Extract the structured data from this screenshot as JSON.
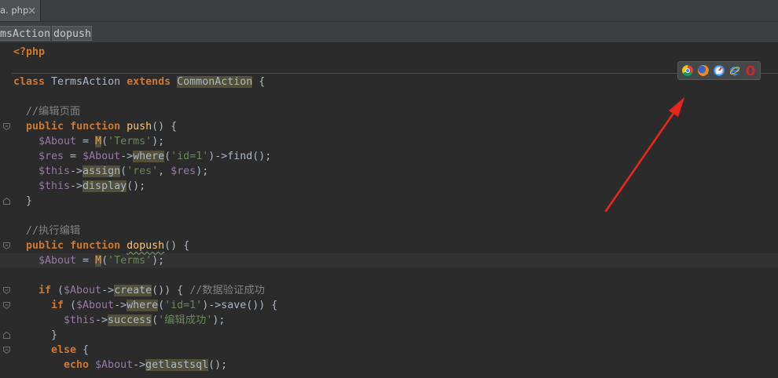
{
  "tabs": [
    {
      "label": "a. php"
    }
  ],
  "tab_close_icon": "close-icon",
  "breadcrumbs": [
    "msAction",
    "dopush"
  ],
  "browser_icons": [
    "chrome-icon",
    "firefox-icon",
    "safari-icon",
    "ie-icon",
    "opera-icon"
  ],
  "colors": {
    "editor_bg": "#2b2b2b",
    "chrome_bg": "#3c3f41",
    "text": "#a9b7c6",
    "keyword": "#cc7832",
    "variable": "#9876aa",
    "string": "#6a8759",
    "comment": "#808080",
    "function": "#ffc66d",
    "usage_highlight": "#52503a",
    "caret_line": "#323232",
    "annotation": "#e8261d"
  },
  "code": {
    "lines": [
      {
        "tokens": [
          {
            "t": "<?php",
            "k": "kw"
          }
        ]
      },
      {
        "tokens": []
      },
      {
        "tokens": [
          {
            "t": "class",
            "k": "kw"
          },
          {
            "t": " TermsAction ",
            "k": "plain"
          },
          {
            "t": "extends",
            "k": "kw"
          },
          {
            "t": " ",
            "k": "plain"
          },
          {
            "t": "CommonAction",
            "k": "hl"
          },
          {
            "t": " {",
            "k": "plain"
          }
        ]
      },
      {
        "tokens": []
      },
      {
        "tokens": [
          {
            "t": "//编辑页面",
            "k": "cmt"
          }
        ]
      },
      {
        "tokens": [
          {
            "t": "public",
            "k": "kw"
          },
          {
            "t": " ",
            "k": "plain"
          },
          {
            "t": "function",
            "k": "kw"
          },
          {
            "t": " ",
            "k": "plain"
          },
          {
            "t": "push",
            "k": "fn"
          },
          {
            "t": "() {",
            "k": "plain"
          }
        ]
      },
      {
        "tokens": [
          {
            "t": "$About",
            "k": "var"
          },
          {
            "t": " = ",
            "k": "plain"
          },
          {
            "t": "M",
            "k": "mcall"
          },
          {
            "t": "(",
            "k": "plain"
          },
          {
            "t": "'Terms'",
            "k": "str"
          },
          {
            "t": ");",
            "k": "plain"
          }
        ]
      },
      {
        "tokens": [
          {
            "t": "$res",
            "k": "var"
          },
          {
            "t": " = ",
            "k": "plain"
          },
          {
            "t": "$About",
            "k": "var"
          },
          {
            "t": "->",
            "k": "plain"
          },
          {
            "t": "where",
            "k": "hl"
          },
          {
            "t": "(",
            "k": "plain"
          },
          {
            "t": "'id=1'",
            "k": "str"
          },
          {
            "t": ")->find();",
            "k": "plain"
          }
        ]
      },
      {
        "tokens": [
          {
            "t": "$this",
            "k": "var"
          },
          {
            "t": "->",
            "k": "plain"
          },
          {
            "t": "assign",
            "k": "hl"
          },
          {
            "t": "(",
            "k": "plain"
          },
          {
            "t": "'res'",
            "k": "str"
          },
          {
            "t": ", ",
            "k": "plain"
          },
          {
            "t": "$res",
            "k": "var"
          },
          {
            "t": ");",
            "k": "plain"
          }
        ]
      },
      {
        "tokens": [
          {
            "t": "$this",
            "k": "var"
          },
          {
            "t": "->",
            "k": "plain"
          },
          {
            "t": "display",
            "k": "hl"
          },
          {
            "t": "();",
            "k": "plain"
          }
        ]
      },
      {
        "tokens": [
          {
            "t": "}",
            "k": "plain"
          }
        ]
      },
      {
        "tokens": []
      },
      {
        "tokens": [
          {
            "t": "//执行编辑",
            "k": "cmt"
          }
        ]
      },
      {
        "tokens": [
          {
            "t": "public",
            "k": "kw"
          },
          {
            "t": " ",
            "k": "plain"
          },
          {
            "t": "function",
            "k": "kw"
          },
          {
            "t": " ",
            "k": "plain"
          },
          {
            "t": "dopush",
            "k": "typo"
          },
          {
            "t": "() {",
            "k": "plain"
          }
        ]
      },
      {
        "tokens": [
          {
            "t": "$About",
            "k": "var"
          },
          {
            "t": " = ",
            "k": "plain"
          },
          {
            "t": "M",
            "k": "mcall"
          },
          {
            "t": "(",
            "k": "plain"
          },
          {
            "t": "'Terms'",
            "k": "str"
          },
          {
            "t": ");",
            "k": "plain"
          }
        ]
      },
      {
        "tokens": []
      },
      {
        "tokens": [
          {
            "t": "if",
            "k": "kw"
          },
          {
            "t": " (",
            "k": "plain"
          },
          {
            "t": "$About",
            "k": "var"
          },
          {
            "t": "->",
            "k": "plain"
          },
          {
            "t": "create",
            "k": "hl"
          },
          {
            "t": "()) { ",
            "k": "plain"
          },
          {
            "t": "//数据验证成功",
            "k": "cmt"
          }
        ]
      },
      {
        "tokens": [
          {
            "t": "if",
            "k": "kw"
          },
          {
            "t": " (",
            "k": "plain"
          },
          {
            "t": "$About",
            "k": "var"
          },
          {
            "t": "->",
            "k": "plain"
          },
          {
            "t": "where",
            "k": "hl"
          },
          {
            "t": "(",
            "k": "plain"
          },
          {
            "t": "'id=1'",
            "k": "str"
          },
          {
            "t": ")->save()) {",
            "k": "plain"
          }
        ]
      },
      {
        "tokens": [
          {
            "t": "$this",
            "k": "var"
          },
          {
            "t": "->",
            "k": "plain"
          },
          {
            "t": "success",
            "k": "hl"
          },
          {
            "t": "(",
            "k": "plain"
          },
          {
            "t": "'编辑成功'",
            "k": "str"
          },
          {
            "t": ");",
            "k": "plain"
          }
        ]
      },
      {
        "tokens": [
          {
            "t": "}",
            "k": "plain"
          }
        ]
      },
      {
        "tokens": [
          {
            "t": "else",
            "k": "kw"
          },
          {
            "t": " {",
            "k": "plain"
          }
        ]
      },
      {
        "tokens": [
          {
            "t": "echo",
            "k": "kw"
          },
          {
            "t": " ",
            "k": "plain"
          },
          {
            "t": "$About",
            "k": "var"
          },
          {
            "t": "->",
            "k": "plain"
          },
          {
            "t": "getlastsql",
            "k": "hl"
          },
          {
            "t": "();",
            "k": "plain"
          }
        ]
      }
    ]
  }
}
